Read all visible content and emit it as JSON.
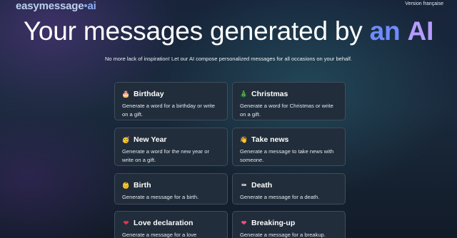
{
  "header": {
    "logo_main": "easymessage",
    "logo_dot": "•",
    "logo_ai": "ai",
    "language_link": "Version française"
  },
  "hero": {
    "title_main": "Your messages generated by ",
    "title_accent1": "an",
    "title_accent2": "AI",
    "subtitle": "No more lack of inspiration! Let our AI compose personalized messages for all occasions on your behalf."
  },
  "occasions": [
    {
      "icon": "birthday-cake-icon",
      "glyph": "🎂",
      "title": "Birthday",
      "description": "Generate a word for a birthday or write on a gift."
    },
    {
      "icon": "christmas-tree-icon",
      "glyph": "🎄",
      "title": "Christmas",
      "description": "Generate a word for Christmas or write on a gift."
    },
    {
      "icon": "party-face-icon",
      "glyph": "🥳",
      "title": "New Year",
      "description": "Generate a word for the new year or write on a gift."
    },
    {
      "icon": "waving-hand-icon",
      "glyph": "👋",
      "title": "Take news",
      "description": "Generate a message to take news with someone."
    },
    {
      "icon": "baby-icon",
      "glyph": "👶",
      "title": "Birth",
      "description": "Generate a message for a birth."
    },
    {
      "icon": "coffin-icon",
      "glyph": "⚰",
      "title": "Death",
      "description": "Generate a message for a death."
    },
    {
      "icon": "red-heart-icon",
      "glyph": "❤",
      "title": "Love declaration",
      "description": "Generate a message for a love"
    },
    {
      "icon": "heart-icon",
      "glyph": "❤",
      "title": "Breaking-up",
      "description": "Generate a message for a breakup."
    }
  ],
  "colors": {
    "background": "#17243a",
    "card": "#212d3b",
    "card_border": "#3f4d5d",
    "accent_blue": "#6f8bff",
    "accent_violet": "#b59cff",
    "heart_red": "#e0354a",
    "heart_pink": "#ef4f73"
  }
}
